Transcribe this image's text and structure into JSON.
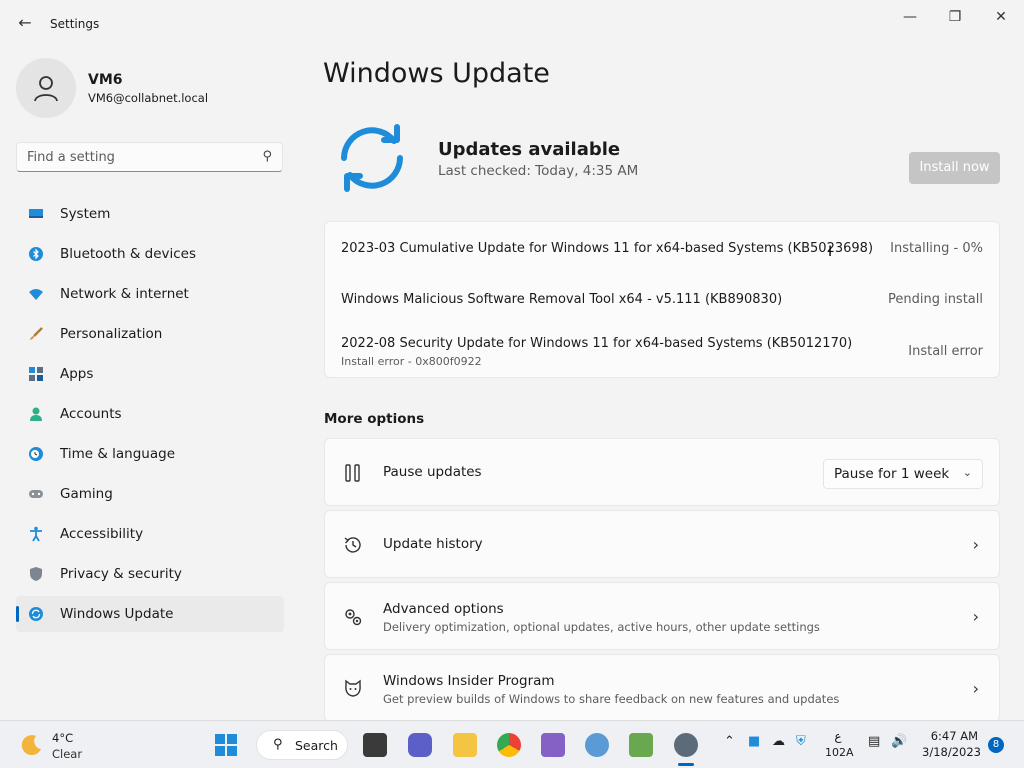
{
  "window": {
    "title": "Settings"
  },
  "profile": {
    "name": "VM6",
    "email": "VM6@collabnet.local"
  },
  "search": {
    "placeholder": "Find a setting"
  },
  "sidebar": {
    "items": [
      {
        "label": "System",
        "icon": "monitor-icon"
      },
      {
        "label": "Bluetooth & devices",
        "icon": "bluetooth-icon"
      },
      {
        "label": "Network & internet",
        "icon": "wifi-icon"
      },
      {
        "label": "Personalization",
        "icon": "brush-icon"
      },
      {
        "label": "Apps",
        "icon": "apps-icon"
      },
      {
        "label": "Accounts",
        "icon": "person-icon"
      },
      {
        "label": "Time & language",
        "icon": "clock-globe-icon"
      },
      {
        "label": "Gaming",
        "icon": "gamepad-icon"
      },
      {
        "label": "Accessibility",
        "icon": "accessibility-icon"
      },
      {
        "label": "Privacy & security",
        "icon": "shield-icon"
      },
      {
        "label": "Windows Update",
        "icon": "update-icon",
        "active": true
      }
    ]
  },
  "main": {
    "title": "Windows Update",
    "status_title": "Updates available",
    "status_sub": "Last checked: Today, 4:35 AM",
    "install_button": "Install now",
    "updates": [
      {
        "name": "2023-03 Cumulative Update for Windows 11 for x64-based Systems (KB5023698)",
        "status": "Installing - 0%"
      },
      {
        "name": "Windows Malicious Software Removal Tool x64 - v5.111 (KB890830)",
        "status": "Pending install"
      },
      {
        "name": "2022-08 Security Update for Windows 11 for x64-based Systems (KB5012170)",
        "status": "Install error",
        "detail": "Install error - 0x800f0922"
      }
    ],
    "more_options_label": "More options",
    "options": [
      {
        "title": "Pause updates",
        "dropdown": "Pause for 1 week",
        "icon": "pause-icon"
      },
      {
        "title": "Update history",
        "icon": "history-icon"
      },
      {
        "title": "Advanced options",
        "desc": "Delivery optimization, optional updates, active hours, other update settings",
        "icon": "gears-icon"
      },
      {
        "title": "Windows Insider Program",
        "desc": "Get preview builds of Windows to share feedback on new features and updates",
        "icon": "insider-cat-icon"
      }
    ]
  },
  "taskbar": {
    "weather_temp": "4°C",
    "weather_desc": "Clear",
    "search_label": "Search",
    "lang_top": "ع",
    "lang_bottom": "102A",
    "time": "6:47 AM",
    "date": "3/18/2023",
    "notification_count": "8"
  },
  "colors": {
    "accent": "#0067c0",
    "background": "#f3f3f3",
    "card": "#fbfbfb"
  }
}
